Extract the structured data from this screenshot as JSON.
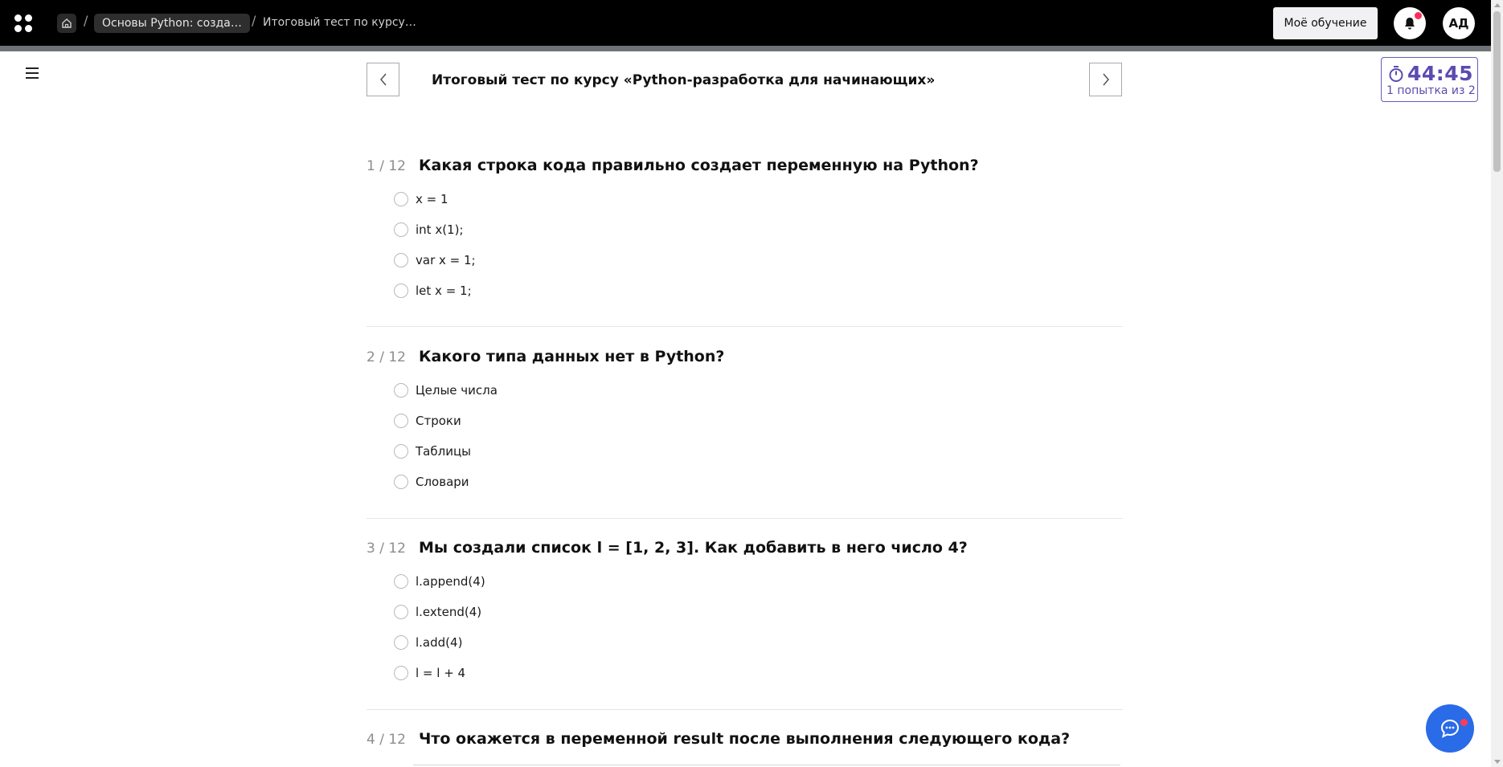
{
  "topbar": {
    "breadcrumb_course": "Основы Python: созда…",
    "breadcrumb_current": "Итоговый тест по курсу…",
    "my_learning_label": "Моё обучение",
    "avatar_initials": "АД",
    "separator": "/"
  },
  "test": {
    "title": "Итоговый тест по курсу «Python-разработка для начинающих»"
  },
  "timer": {
    "time": "44:45",
    "attempts": "1 попытка из 2"
  },
  "questions": [
    {
      "number": "1 / 12",
      "text": "Какая строка кода правильно создает переменную на Python?",
      "options": [
        "x = 1",
        "int x(1);",
        "var x = 1;",
        "let x = 1;"
      ]
    },
    {
      "number": "2 / 12",
      "text": "Какого типа данных нет в Python?",
      "options": [
        "Целые числа",
        "Строки",
        "Таблицы",
        "Словари"
      ]
    },
    {
      "number": "3 / 12",
      "text": "Мы создали список l = [1, 2, 3]. Как добавить в него число 4?",
      "options": [
        "l.append(4)",
        "l.extend(4)",
        "l.add(4)",
        "l = l + 4"
      ]
    },
    {
      "number": "4 / 12",
      "text": "Что окажется в переменной result после выполнения следующего кода?",
      "options": []
    }
  ],
  "colors": {
    "topbar_bg": "#000000",
    "accent_timer": "#5b4bb0",
    "chat_button": "#2a6be8",
    "notification_dot": "#ff2e55"
  }
}
